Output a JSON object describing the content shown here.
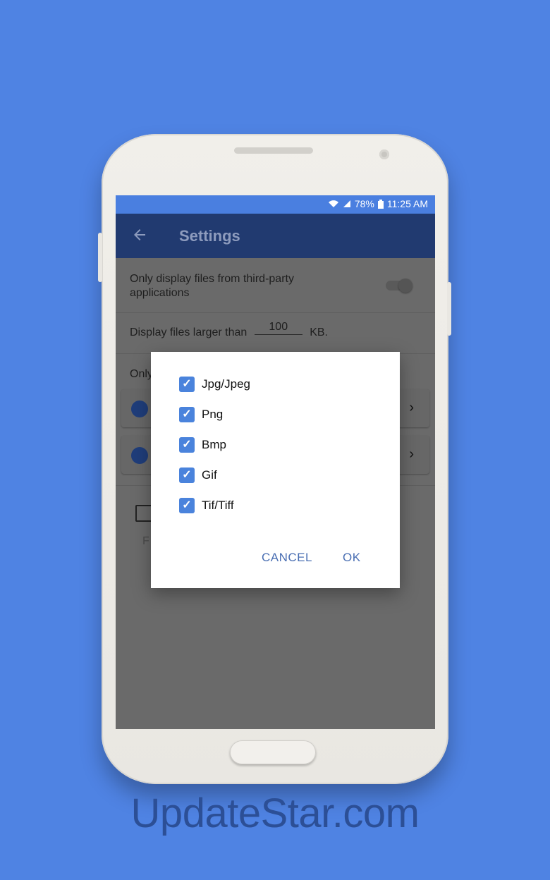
{
  "status_bar": {
    "battery": "78%",
    "time": "11:25 AM"
  },
  "app_bar": {
    "title": "Settings"
  },
  "settings": {
    "third_party_label": "Only display files from third-party applications",
    "size_prefix": "Display files larger than",
    "size_value": "100",
    "size_unit": "KB.",
    "only_prefix": "Only",
    "dim_text": "F"
  },
  "dialog": {
    "options": [
      {
        "label": "Jpg/Jpeg",
        "checked": true
      },
      {
        "label": "Png",
        "checked": true
      },
      {
        "label": "Bmp",
        "checked": true
      },
      {
        "label": "Gif",
        "checked": true
      },
      {
        "label": "Tif/Tiff",
        "checked": true
      }
    ],
    "cancel_label": "CANCEL",
    "ok_label": "OK"
  },
  "watermark": "UpdateStar.com",
  "colors": {
    "background": "#4f83e3",
    "appbar": "#213a70",
    "statusbar": "#4a7fe0",
    "checkbox": "#4a83dc",
    "dialog_button": "#4a6fb3"
  }
}
